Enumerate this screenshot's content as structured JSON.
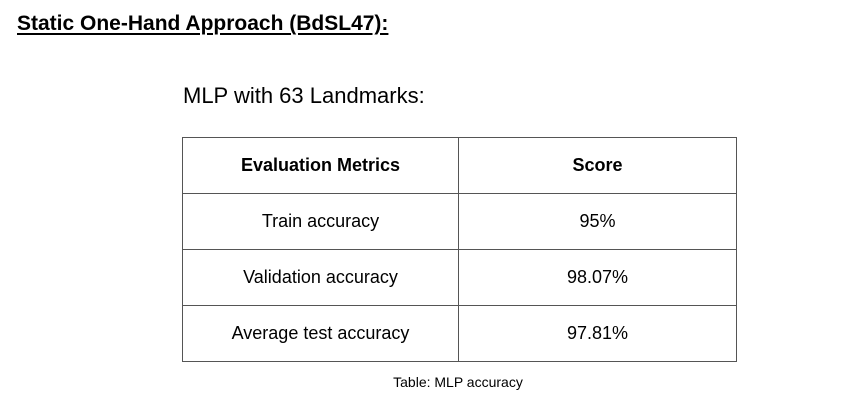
{
  "heading": "Static One-Hand Approach (BdSL47):",
  "subheading": "MLP with 63 Landmarks:",
  "table": {
    "headers": [
      "Evaluation Metrics",
      "Score"
    ],
    "rows": [
      [
        "Train accuracy",
        "95%"
      ],
      [
        "Validation accuracy",
        "98.07%"
      ],
      [
        "Average test accuracy",
        "97.81%"
      ]
    ]
  },
  "caption": "Table: MLP accuracy"
}
